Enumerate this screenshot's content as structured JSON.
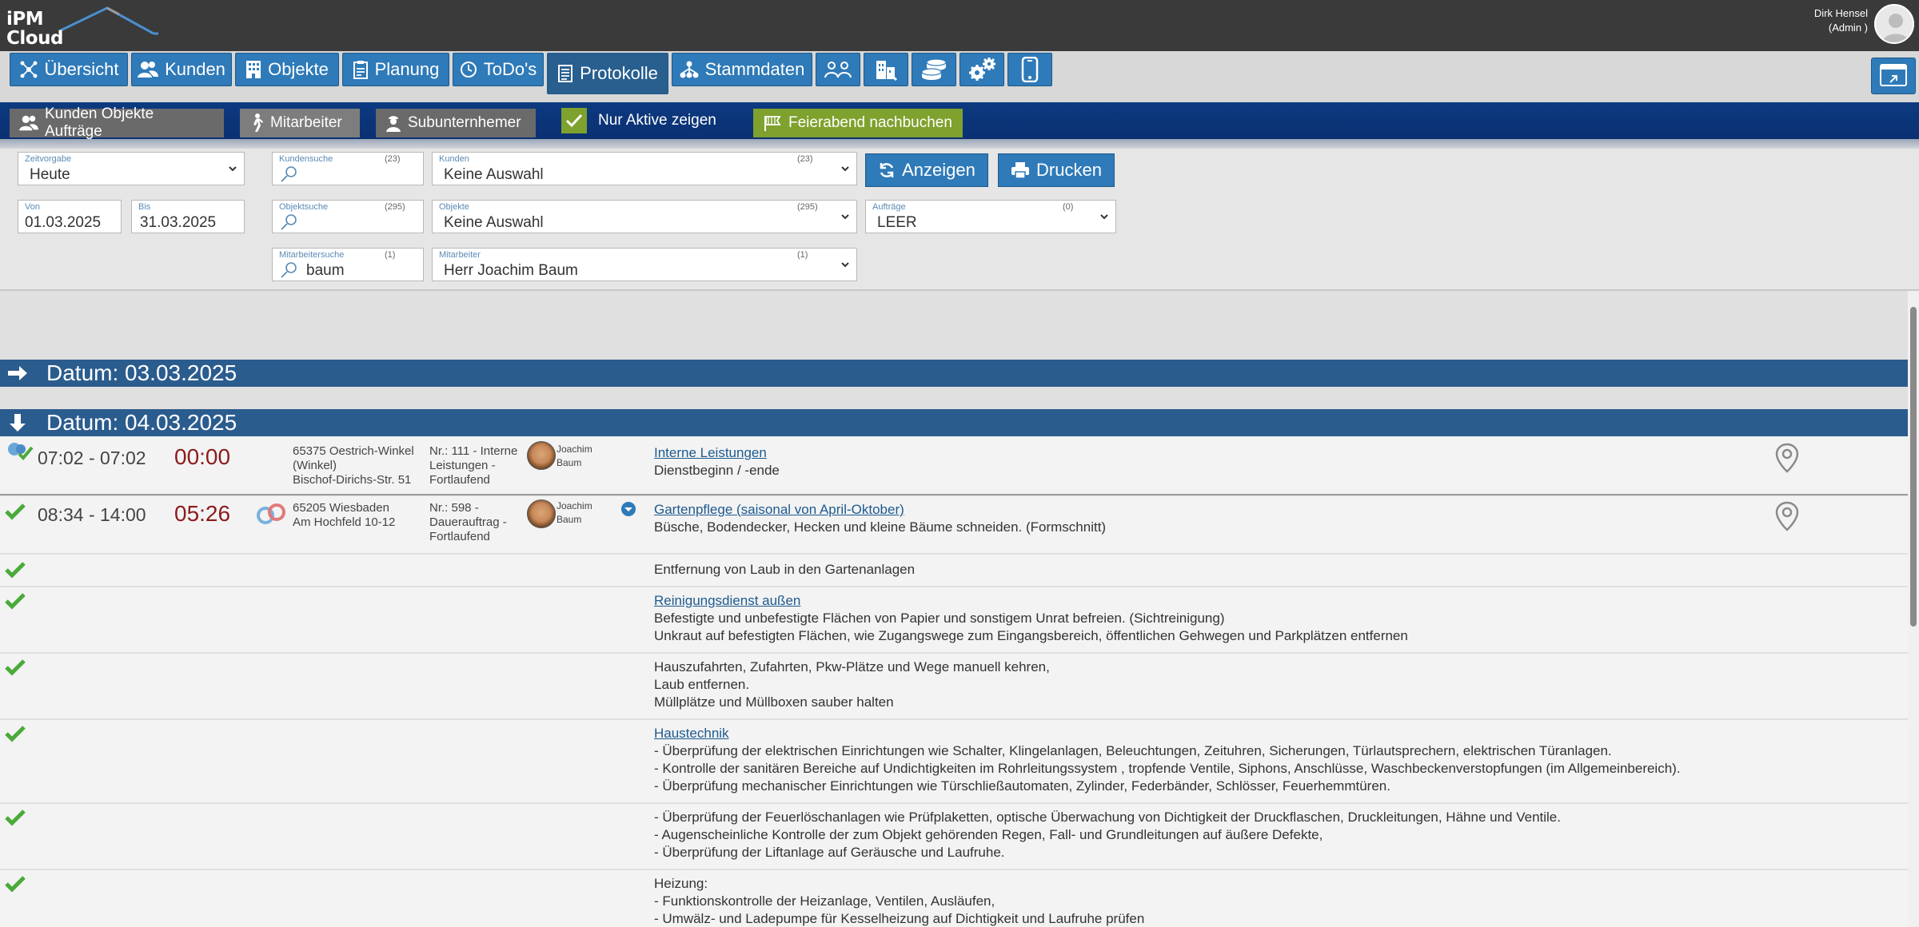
{
  "app": {
    "logo_line1": "iPM",
    "logo_line2": "Cloud",
    "user_name": "Dirk Hensel",
    "user_role": "(Admin )"
  },
  "nav": {
    "tabs": [
      {
        "label": "Übersicht",
        "icon": "network-icon"
      },
      {
        "label": "Kunden",
        "icon": "users-icon"
      },
      {
        "label": "Objekte",
        "icon": "building-icon"
      },
      {
        "label": "Planung",
        "icon": "clipboard-icon"
      },
      {
        "label": "ToDo's",
        "icon": "clock-icon"
      },
      {
        "label": "Protokolle",
        "icon": "document-icon",
        "active": true
      },
      {
        "label": "Stammdaten",
        "icon": "hierarchy-icon"
      }
    ],
    "icon_tabs": [
      "team-icon",
      "city-icon",
      "coins-icon",
      "gears-icon",
      "mobile-icon"
    ]
  },
  "band": {
    "btn_customers": "Kunden Objekte Aufträge",
    "btn_employees": "Mitarbeiter",
    "btn_subcontractor": "Subunternhemer",
    "only_active": "Nur Aktive zeigen",
    "btn_closing": "Feierabend nachbuchen"
  },
  "filters": {
    "zeitvorgabe": {
      "label": "Zeitvorgabe",
      "value": "Heute"
    },
    "von": {
      "label": "Von",
      "value": "01.03.2025"
    },
    "bis": {
      "label": "Bis",
      "value": "31.03.2025"
    },
    "kundensuche": {
      "label": "Kundensuche",
      "count": "(23)",
      "value": ""
    },
    "kunden": {
      "label": "Kunden",
      "count": "(23)",
      "value": "Keine Auswahl"
    },
    "objektsuche": {
      "label": "Objektsuche",
      "count": "(295)",
      "value": ""
    },
    "objekte": {
      "label": "Objekte",
      "count": "(295)",
      "value": "Keine Auswahl"
    },
    "auftraege": {
      "label": "Aufträge",
      "count": "(0)",
      "value": "LEER"
    },
    "mitarbeitersuche": {
      "label": "Mitarbeitersuche",
      "count": "(1)",
      "value": "baum"
    },
    "mitarbeiter": {
      "label": "Mitarbeiter",
      "count": "(1)",
      "value": "Herr Joachim Baum"
    },
    "btn_show": "Anzeigen",
    "btn_print": "Drucken"
  },
  "dates": [
    {
      "label": "Datum: 03.03.2025",
      "expanded": false
    },
    {
      "label": "Datum: 04.03.2025",
      "expanded": true
    }
  ],
  "entries": [
    {
      "time": "07:02 - 07:02",
      "duration": "00:00",
      "address": [
        "65375 Oestrich-Winkel",
        "(Winkel)",
        "Bischof-Dirichs-Str. 51"
      ],
      "nr": [
        "Nr.: 111 - Interne",
        "Leistungen -",
        "Fortlaufend"
      ],
      "employee": [
        "Joachim",
        "Baum"
      ],
      "service_title": "Interne Leistungen",
      "service_lines": [
        "Dienstbeginn / -ende"
      ]
    },
    {
      "time": "08:34 - 14:00",
      "duration": "05:26",
      "address": [
        "65205 Wiesbaden",
        "Am Hochfeld 10-12"
      ],
      "nr": [
        "Nr.: 598 -",
        "Dauerauftrag -",
        "Fortlaufend"
      ],
      "employee": [
        "Joachim",
        "Baum"
      ],
      "service_title": "Gartenpflege (saisonal von April-Oktober)",
      "service_lines": [
        "Büsche, Bodendecker, Hecken und kleine Bäume schneiden. (Formschnitt)"
      ]
    }
  ],
  "tasks": [
    {
      "title": "",
      "lines": [
        "Entfernung von Laub in den Gartenanlagen"
      ]
    },
    {
      "title": "Reinigungsdienst außen",
      "lines": [
        "Befestigte und unbefestigte Flächen von Papier und sonstigem Unrat befreien. (Sichtreinigung)",
        "Unkraut auf befestigten Flächen, wie Zugangswege zum Eingangsbereich, öffentlichen Gehwegen und Parkplätzen entfernen"
      ]
    },
    {
      "title": "",
      "lines": [
        "Hauszufahrten, Zufahrten, Pkw-Plätze und Wege manuell kehren,",
        "Laub entfernen.",
        "Müllplätze und Müllboxen sauber halten"
      ]
    },
    {
      "title": "Haustechnik",
      "lines": [
        "- Überprüfung der elektrischen Einrichtungen wie Schalter, Klingelanlagen, Beleuchtungen, Zeituhren, Sicherungen, Türlautsprechern, elektrischen Türanlagen.",
        "- Kontrolle der sanitären Bereiche auf Undichtigkeiten im Rohrleitungssystem , tropfende Ventile, Siphons, Anschlüsse, Waschbeckenverstopfungen (im Allgemeinbereich).",
        "- Überprüfung mechanischer Einrichtungen wie Türschließautomaten, Zylinder, Federbänder, Schlösser, Feuerhemmtüren."
      ]
    },
    {
      "title": "",
      "lines": [
        "- Überprüfung der Feuerlöschanlagen wie Prüfplaketten, optische Überwachung von Dichtigkeit der Druckflaschen, Druckleitungen, Hähne und Ventile.",
        "- Augenscheinliche Kontrolle der zum Objekt gehörenden Regen, Fall- und Grundleitungen auf äußere Defekte,",
        "- Überprüfung der Liftanlage auf Geräusche und Laufruhe."
      ]
    },
    {
      "title": "",
      "lines": [
        "Heizung:",
        "- Funktionskontrolle der Heizanlage, Ventilen, Ausläufen,",
        "- Umwälz- und Ladepumpe für Kesselheizung auf Dichtigkeit und Laufruhe prüfen"
      ]
    }
  ],
  "colors": {
    "accent": "#2f7ab8",
    "band": "#0d3a80",
    "done_green": "#4aaa3a",
    "duration_red": "#8b1c1c"
  }
}
